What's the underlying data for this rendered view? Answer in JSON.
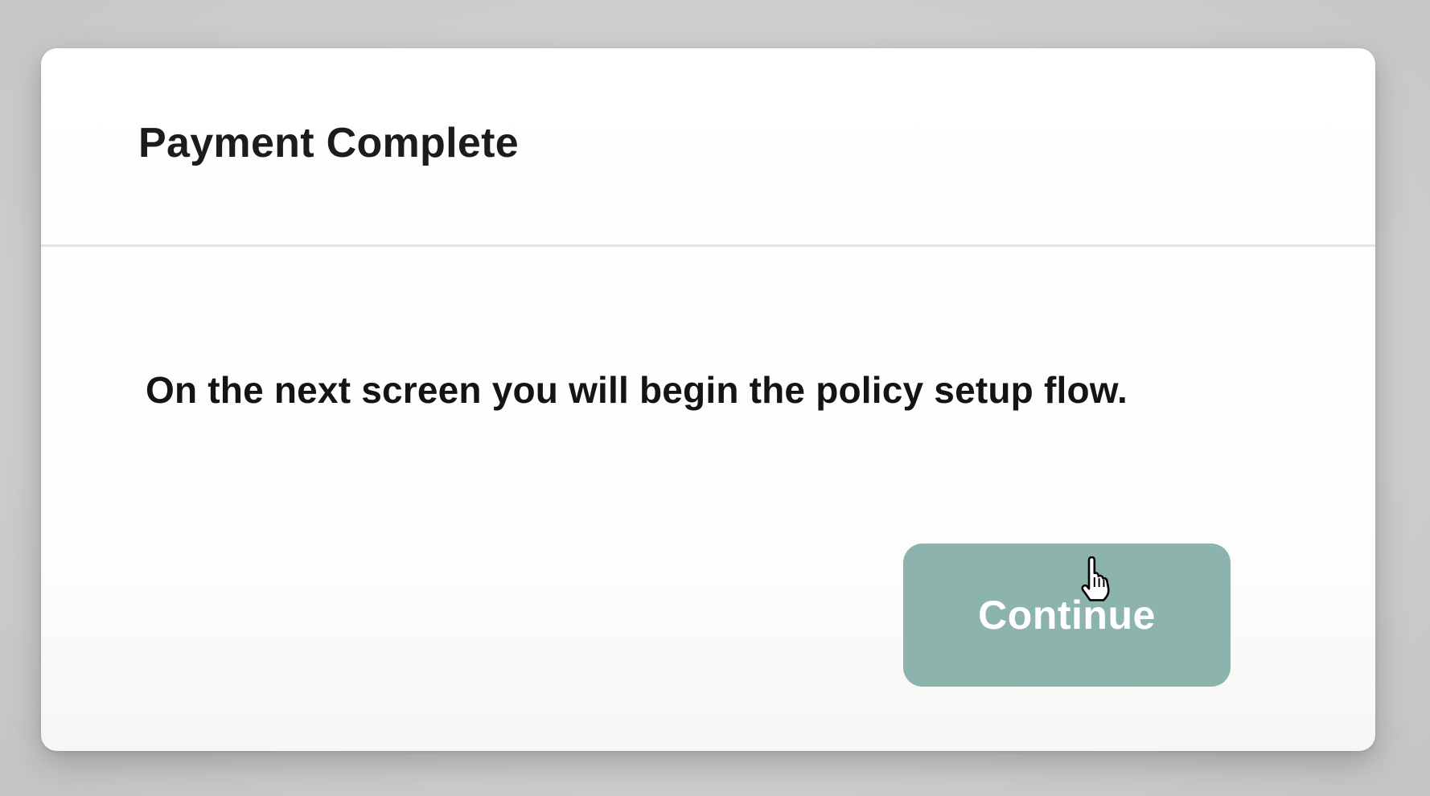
{
  "dialog": {
    "title": "Payment Complete",
    "message": "On the next screen you will begin the policy setup flow.",
    "continue_label": "Continue"
  },
  "colors": {
    "overlay": "#cfd0cf",
    "dialog_background": "#ffffff",
    "divider": "#e3e4e3",
    "button_background": "#8db3ad",
    "button_text": "#ffffff",
    "title_text": "#1c1c1c"
  },
  "cursor": {
    "icon": "hand-pointer-icon"
  }
}
